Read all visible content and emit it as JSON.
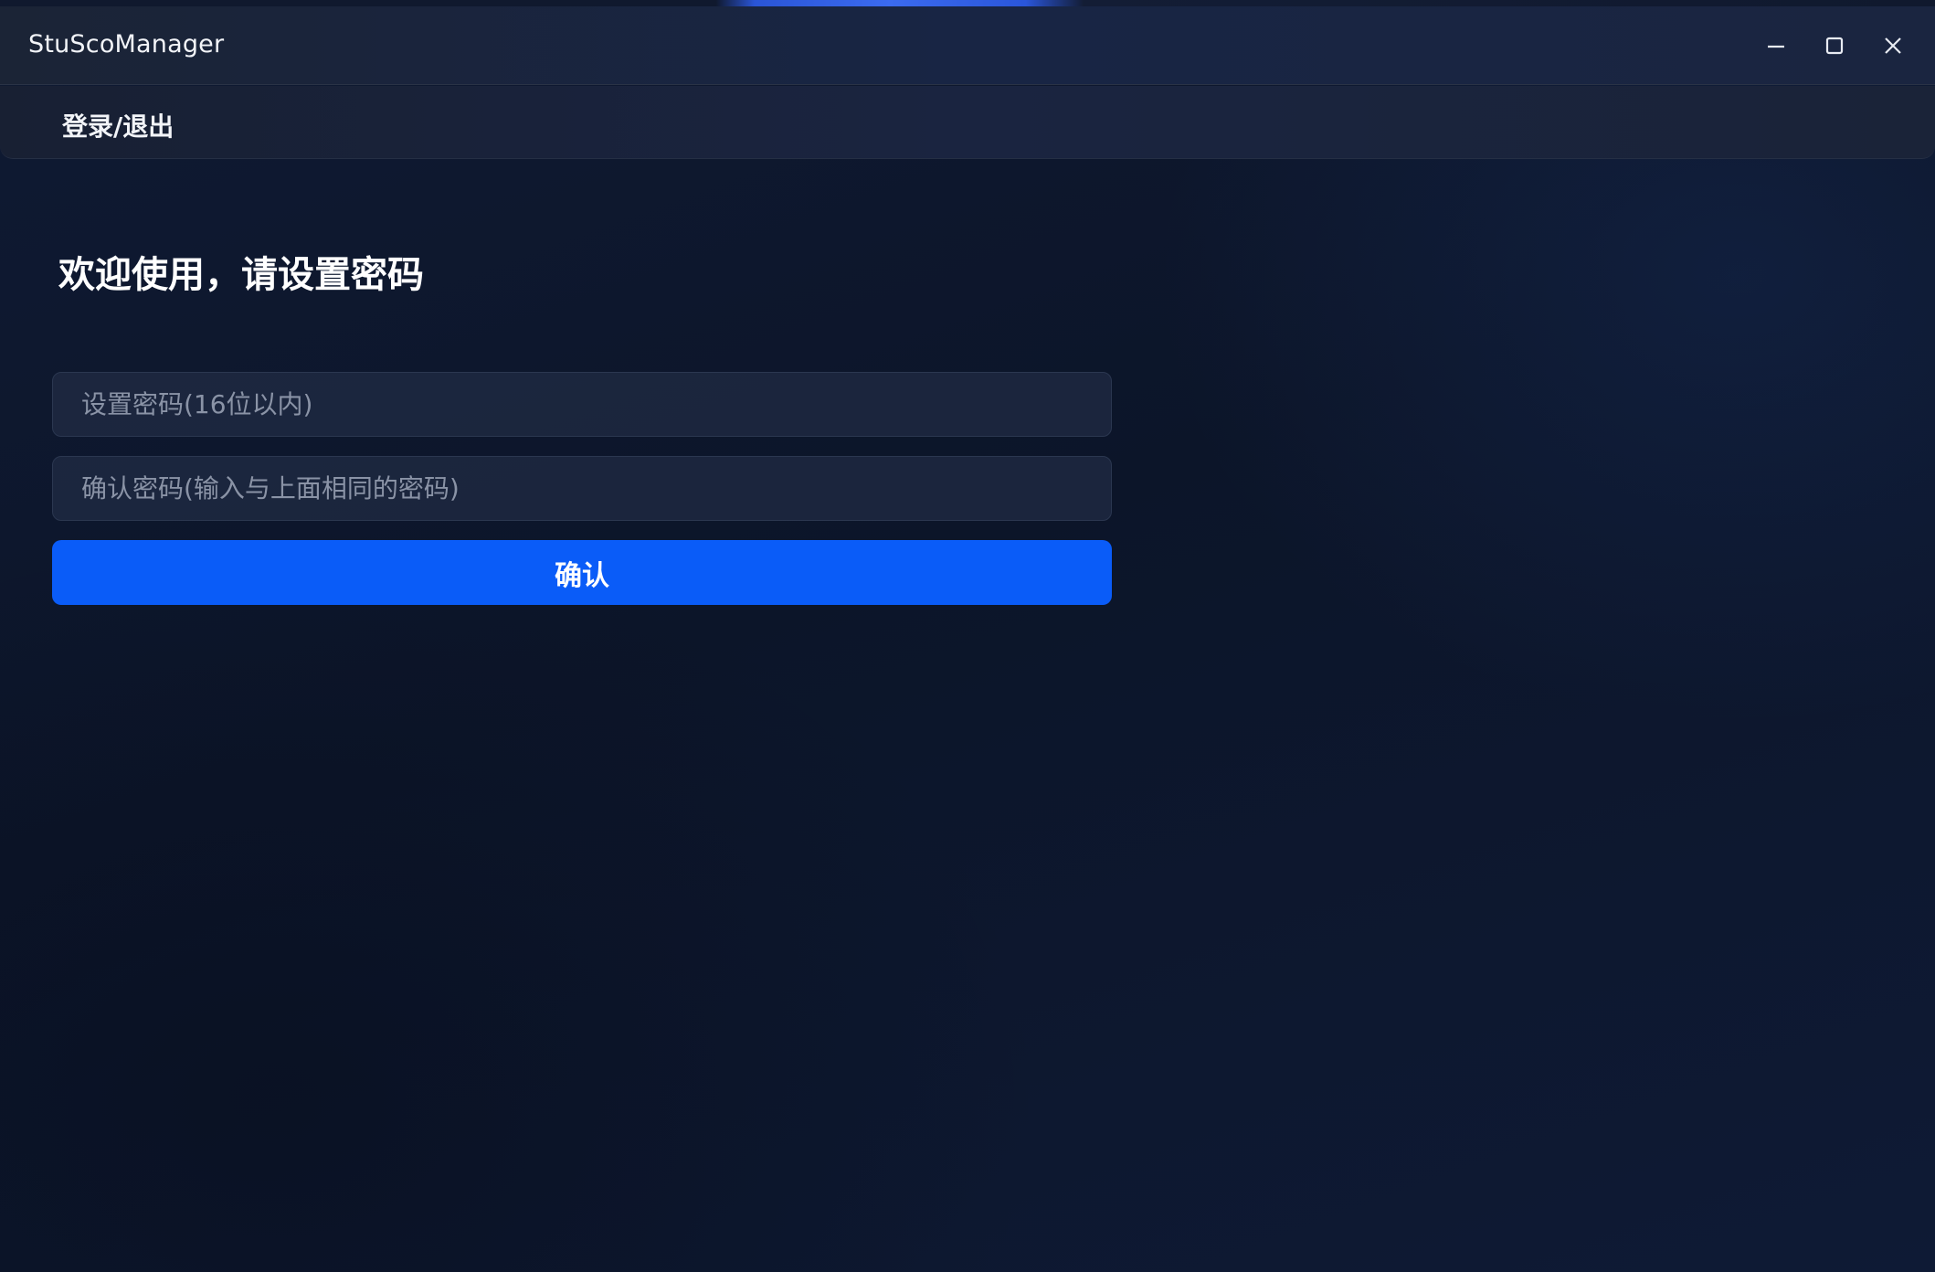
{
  "window": {
    "title": "StuScoManager",
    "controls": {
      "minimize_icon": "minimize-icon",
      "maximize_icon": "maximize-icon",
      "close_icon": "close-icon"
    }
  },
  "menu": {
    "items": [
      {
        "label": "登录/退出"
      }
    ]
  },
  "main": {
    "welcome_text": "欢迎使用，请设置密码",
    "password_input": {
      "value": "",
      "placeholder": "设置密码(16位以内)"
    },
    "confirm_input": {
      "value": "",
      "placeholder": "确认密码(输入与上面相同的密码)"
    },
    "confirm_button_label": "确认"
  },
  "colors": {
    "accent": "#0a5cf8",
    "background": "#0d1526",
    "text": "#ffffff",
    "placeholder": "#8a93a6"
  }
}
